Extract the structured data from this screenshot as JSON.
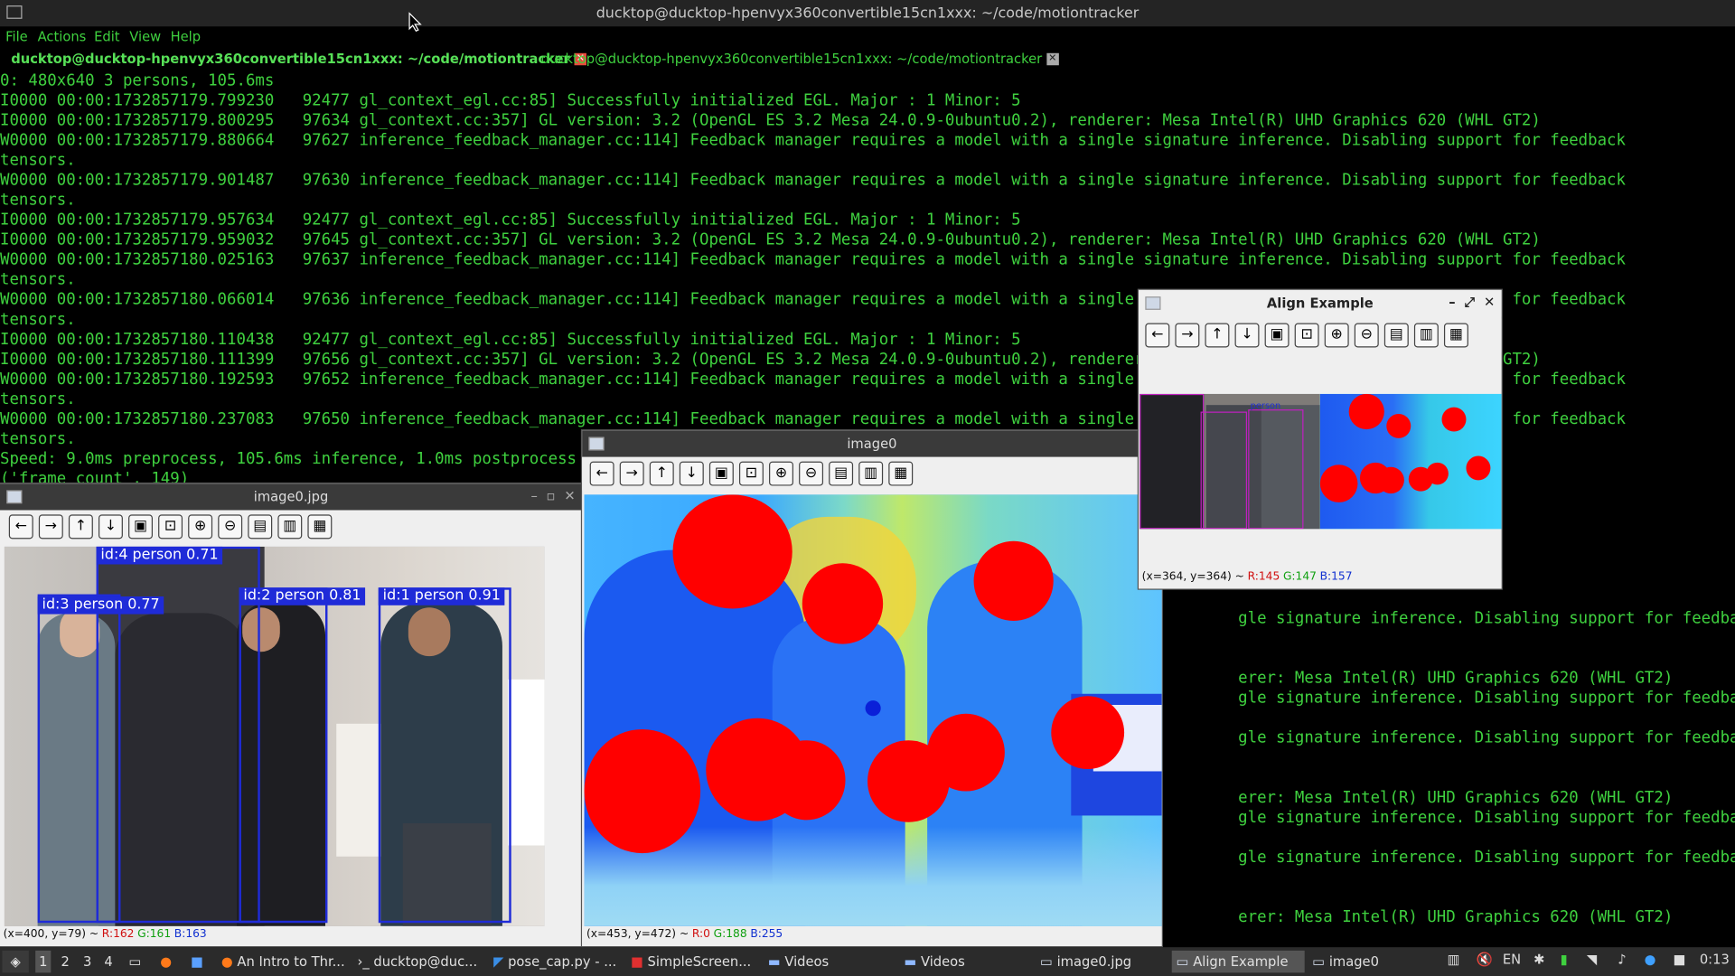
{
  "terminal": {
    "window_title": "ducktop@ducktop-hpenvyx360convertible15cn1xxx: ~/code/motiontracker",
    "menu": [
      "File",
      "Actions",
      "Edit",
      "View",
      "Help"
    ],
    "tabs": [
      {
        "label": "ducktop@ducktop-hpenvyx360convertible15cn1xxx: ~/code/motiontracker",
        "active": true
      },
      {
        "label": "ducktop@ducktop-hpenvyx360convertible15cn1xxx: ~/code/motiontracker",
        "active": false
      }
    ],
    "lines": [
      "0: 480x640 3 persons, 105.6ms",
      "I0000 00:00:1732857179.799230   92477 gl_context_egl.cc:85] Successfully initialized EGL. Major : 1 Minor: 5",
      "I0000 00:00:1732857179.800295   97634 gl_context.cc:357] GL version: 3.2 (OpenGL ES 3.2 Mesa 24.0.9-0ubuntu0.2), renderer: Mesa Intel(R) UHD Graphics 620 (WHL GT2)",
      "W0000 00:00:1732857179.880664   97627 inference_feedback_manager.cc:114] Feedback manager requires a model with a single signature inference. Disabling support for feedback",
      "tensors.",
      "W0000 00:00:1732857179.901487   97630 inference_feedback_manager.cc:114] Feedback manager requires a model with a single signature inference. Disabling support for feedback",
      "tensors.",
      "I0000 00:00:1732857179.957634   92477 gl_context_egl.cc:85] Successfully initialized EGL. Major : 1 Minor: 5",
      "I0000 00:00:1732857179.959032   97645 gl_context.cc:357] GL version: 3.2 (OpenGL ES 3.2 Mesa 24.0.9-0ubuntu0.2), renderer: Mesa Intel(R) UHD Graphics 620 (WHL GT2)",
      "W0000 00:00:1732857180.025163   97637 inference_feedback_manager.cc:114] Feedback manager requires a model with a single signature inference. Disabling support for feedback",
      "tensors.",
      "W0000 00:00:1732857180.066014   97636 inference_feedback_manager.cc:114] Feedback manager requires a model with a single signature inference. Disabling support for feedback",
      "tensors.",
      "I0000 00:00:1732857180.110438   92477 gl_context_egl.cc:85] Successfully initialized EGL. Major : 1 Minor: 5",
      "I0000 00:00:1732857180.111399   97656 gl_context.cc:357] GL version: 3.2 (OpenGL ES 3.2 Mesa 24.0.9-0ubuntu0.2), renderer: Mesa Intel(R) UHD Graphics 620 (WHL GT2)",
      "W0000 00:00:1732857180.192593   97652 inference_feedback_manager.cc:114] Feedback manager requires a model with a single signature inference. Disabling support for feedback",
      "tensors.",
      "W0000 00:00:1732857180.237083   97650 inference_feedback_manager.cc:114] Feedback manager requires a model with a single signature inference. Disabling support for feedback",
      "tensors.",
      "Speed: 9.0ms preprocess, 105.6ms inference, 1.0ms postprocess per image at shape (1, 3, 480, 640)",
      "('frame_count', 149)",
      "",
      "",
      "",
      "                                                                                                                                            20 (WHL GT2)",
      "                                                                                                                                          support for feedback",
      "",
      "                                                                                                                                   gle signature inference. Disabling support for feedback",
      "",
      "",
      "                                                                                                                                   erer: Mesa Intel(R) UHD Graphics 620 (WHL GT2)",
      "                                                                                                                                   gle signature inference. Disabling support for feedback",
      "",
      "                                                                                                                                   gle signature inference. Disabling support for feedback",
      "",
      "",
      "                                                                                                                                   erer: Mesa Intel(R) UHD Graphics 620 (WHL GT2)",
      "                                                                                                                                   gle signature inference. Disabling support for feedback",
      "",
      "                                                                                                                                   gle signature inference. Disabling support for feedback",
      "",
      "",
      "                                                                                                                                   erer: Mesa Intel(R) UHD Graphics 620 (WHL GT2)"
    ]
  },
  "window_image0jpg": {
    "title": "image0.jpg",
    "detections": [
      {
        "label": "id:4 person 0.71",
        "color": "#1f2bd8"
      },
      {
        "label": "id:3 person 0.77",
        "color": "#1f2bd8"
      },
      {
        "label": "id:2 person 0.81",
        "color": "#1f2bd8"
      },
      {
        "label": "id:1 person 0.91",
        "color": "#1f2bd8"
      }
    ],
    "status": {
      "coords": "(x=400, y=79) ~",
      "r": "R:162",
      "g": "G:161",
      "b": "B:163"
    }
  },
  "window_image0": {
    "title": "image0",
    "status": {
      "coords": "(x=453, y=472) ~",
      "r": "R:0",
      "g": "G:188",
      "b": "B:255"
    }
  },
  "window_align": {
    "title": "Align Example",
    "thumb_label": "person",
    "status": {
      "coords": "(x=364, y=364) ~",
      "r": "R:145",
      "g": "G:147",
      "b": "B:157"
    }
  },
  "toolbar_icons": [
    "arrow-left-icon",
    "arrow-right-icon",
    "arrow-up-icon",
    "arrow-down-icon",
    "zoom-fit-icon",
    "zoom-original-icon",
    "zoom-in-icon",
    "zoom-out-icon",
    "save-icon",
    "copy-icon",
    "properties-icon"
  ],
  "taskbar": {
    "workspaces": [
      "1",
      "2",
      "3",
      "4"
    ],
    "tasks": [
      {
        "label": "An Intro to Thr..."
      },
      {
        "label": "ducktop@duc..."
      },
      {
        "label": "pose_cap.py - ..."
      },
      {
        "label": "SimpleScreen..."
      },
      {
        "label": "Videos"
      },
      {
        "label": "Videos"
      },
      {
        "label": "image0.jpg"
      },
      {
        "label": "Align Example"
      },
      {
        "label": "image0"
      }
    ],
    "keyboard_layout": "EN",
    "clock": "0:13"
  }
}
